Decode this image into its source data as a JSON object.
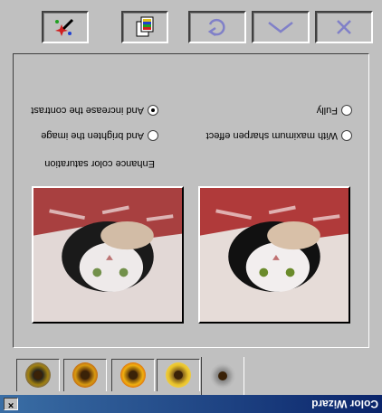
{
  "window": {
    "title": "Color Wizard",
    "close_glyph": "×"
  },
  "tabs": [
    {
      "icon": "flower-gray-icon",
      "active": true
    },
    {
      "icon": "flower-yellow-icon",
      "active": false
    },
    {
      "icon": "flower-red-icon",
      "active": false
    },
    {
      "icon": "flower-dark-icon",
      "active": false
    },
    {
      "icon": "flower-blue-icon",
      "active": false
    }
  ],
  "section": {
    "label": "Enhance color saturation"
  },
  "options": [
    {
      "label": "With maximum sharpen effect",
      "checked": false
    },
    {
      "label": "And brighten the image",
      "checked": false
    },
    {
      "label": "Fully",
      "checked": false
    },
    {
      "label": "And increase the contrast",
      "checked": true
    }
  ],
  "toolbar": {
    "buttons": [
      {
        "icon": "close-icon"
      },
      {
        "icon": "chevron-up-icon"
      },
      {
        "icon": "redo-icon"
      },
      {
        "icon": "copy-color-icon"
      },
      {
        "icon": "magic-wand-icon"
      }
    ]
  },
  "colors": {
    "titlebar_start": "#0a246a",
    "titlebar_end": "#3a6ea5",
    "face": "#c0c0c0",
    "toolbar_icon": "#8080c8"
  }
}
